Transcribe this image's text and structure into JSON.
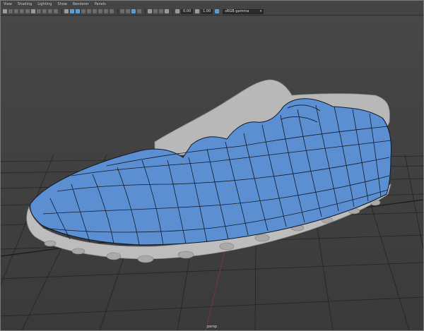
{
  "menu": {
    "items": [
      "View",
      "Shading",
      "Lighting",
      "Show",
      "Renderer",
      "Panels"
    ]
  },
  "toolbar": {
    "exposure": "0.00",
    "gamma": "1.00",
    "color_space": "sRGB gamma"
  },
  "viewport": {
    "camera": "persp"
  },
  "colors": {
    "background": "#444444",
    "mesh_fill": "#5b8fd1",
    "mesh_wire": "#0f1a2a",
    "shoe_gray": "#bdbdbd",
    "grid_line": "#202020",
    "axis_red": "#8a3a3a"
  }
}
